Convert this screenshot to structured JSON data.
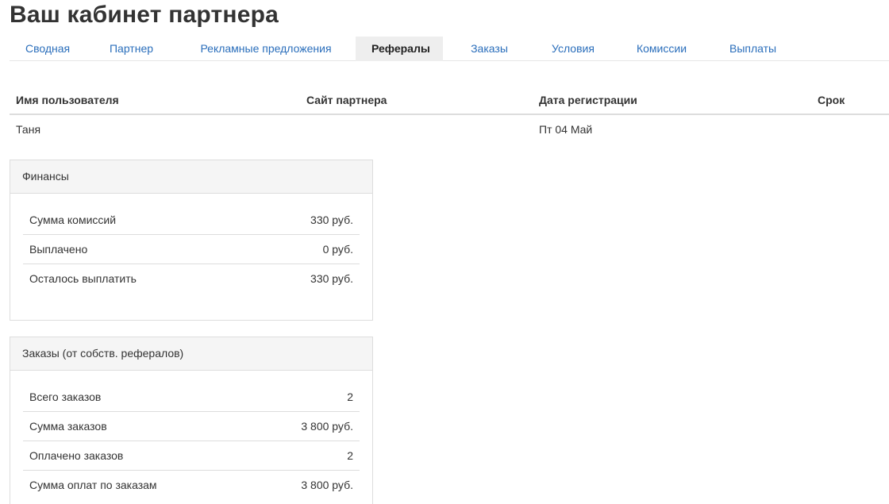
{
  "page": {
    "title": "Ваш кабинет партнера"
  },
  "tabs": [
    {
      "label": "Сводная",
      "active": false
    },
    {
      "label": "Партнер",
      "active": false
    },
    {
      "label": "Рекламные предложения",
      "active": false
    },
    {
      "label": "Рефералы",
      "active": true
    },
    {
      "label": "Заказы",
      "active": false
    },
    {
      "label": "Условия",
      "active": false
    },
    {
      "label": "Комиссии",
      "active": false
    },
    {
      "label": "Выплаты",
      "active": false
    }
  ],
  "referrals": {
    "columns": [
      "Имя пользователя",
      "Сайт партнера",
      "Дата регистрации",
      "Срок"
    ],
    "rows": [
      {
        "username": "Таня",
        "site": "",
        "date": "Пт 04 Май",
        "term": ""
      }
    ]
  },
  "finance": {
    "heading": "Финансы",
    "rows": [
      {
        "label": "Сумма комиссий",
        "value": "330 руб."
      },
      {
        "label": "Выплачено",
        "value": "0 руб."
      },
      {
        "label": "Осталось выплатить",
        "value": "330 руб."
      }
    ]
  },
  "orders": {
    "heading": "Заказы (от собств. рефералов)",
    "rows": [
      {
        "label": "Всего заказов",
        "value": "2"
      },
      {
        "label": "Сумма заказов",
        "value": "3 800 руб."
      },
      {
        "label": "Оплачено заказов",
        "value": "2"
      },
      {
        "label": "Сумма оплат по заказам",
        "value": "3 800 руб."
      }
    ]
  }
}
